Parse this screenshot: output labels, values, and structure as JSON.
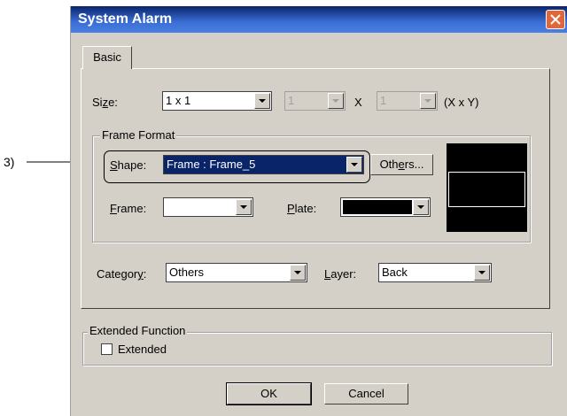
{
  "callout": {
    "label": "3)"
  },
  "window": {
    "title": "System Alarm"
  },
  "tabs": [
    {
      "label": "Basic"
    }
  ],
  "size": {
    "label": "Size:",
    "value": "1 x 1",
    "x_value": "1",
    "x_sep": "X",
    "y_value": "1",
    "unit": "(X x Y)"
  },
  "frame_format": {
    "title": "Frame Format",
    "shape_label": "Shape:",
    "shape_value": "Frame : Frame_5",
    "others_button": "Others...",
    "frame_label": "Frame:",
    "frame_color": "#ffffff",
    "plate_label": "Plate:",
    "plate_color": "#000000"
  },
  "category": {
    "label": "Category:",
    "value": "Others"
  },
  "layer": {
    "label": "Layer:",
    "value": "Back"
  },
  "extended": {
    "title": "Extended Function",
    "checkbox_label": "Extended",
    "checked": false
  },
  "buttons": {
    "ok": "OK",
    "cancel": "Cancel"
  },
  "colors": {
    "title_start": "#0a246a",
    "title_end": "#4a80e0",
    "selection": "#0a246a",
    "dialog_bg": "#d4d0c8"
  }
}
